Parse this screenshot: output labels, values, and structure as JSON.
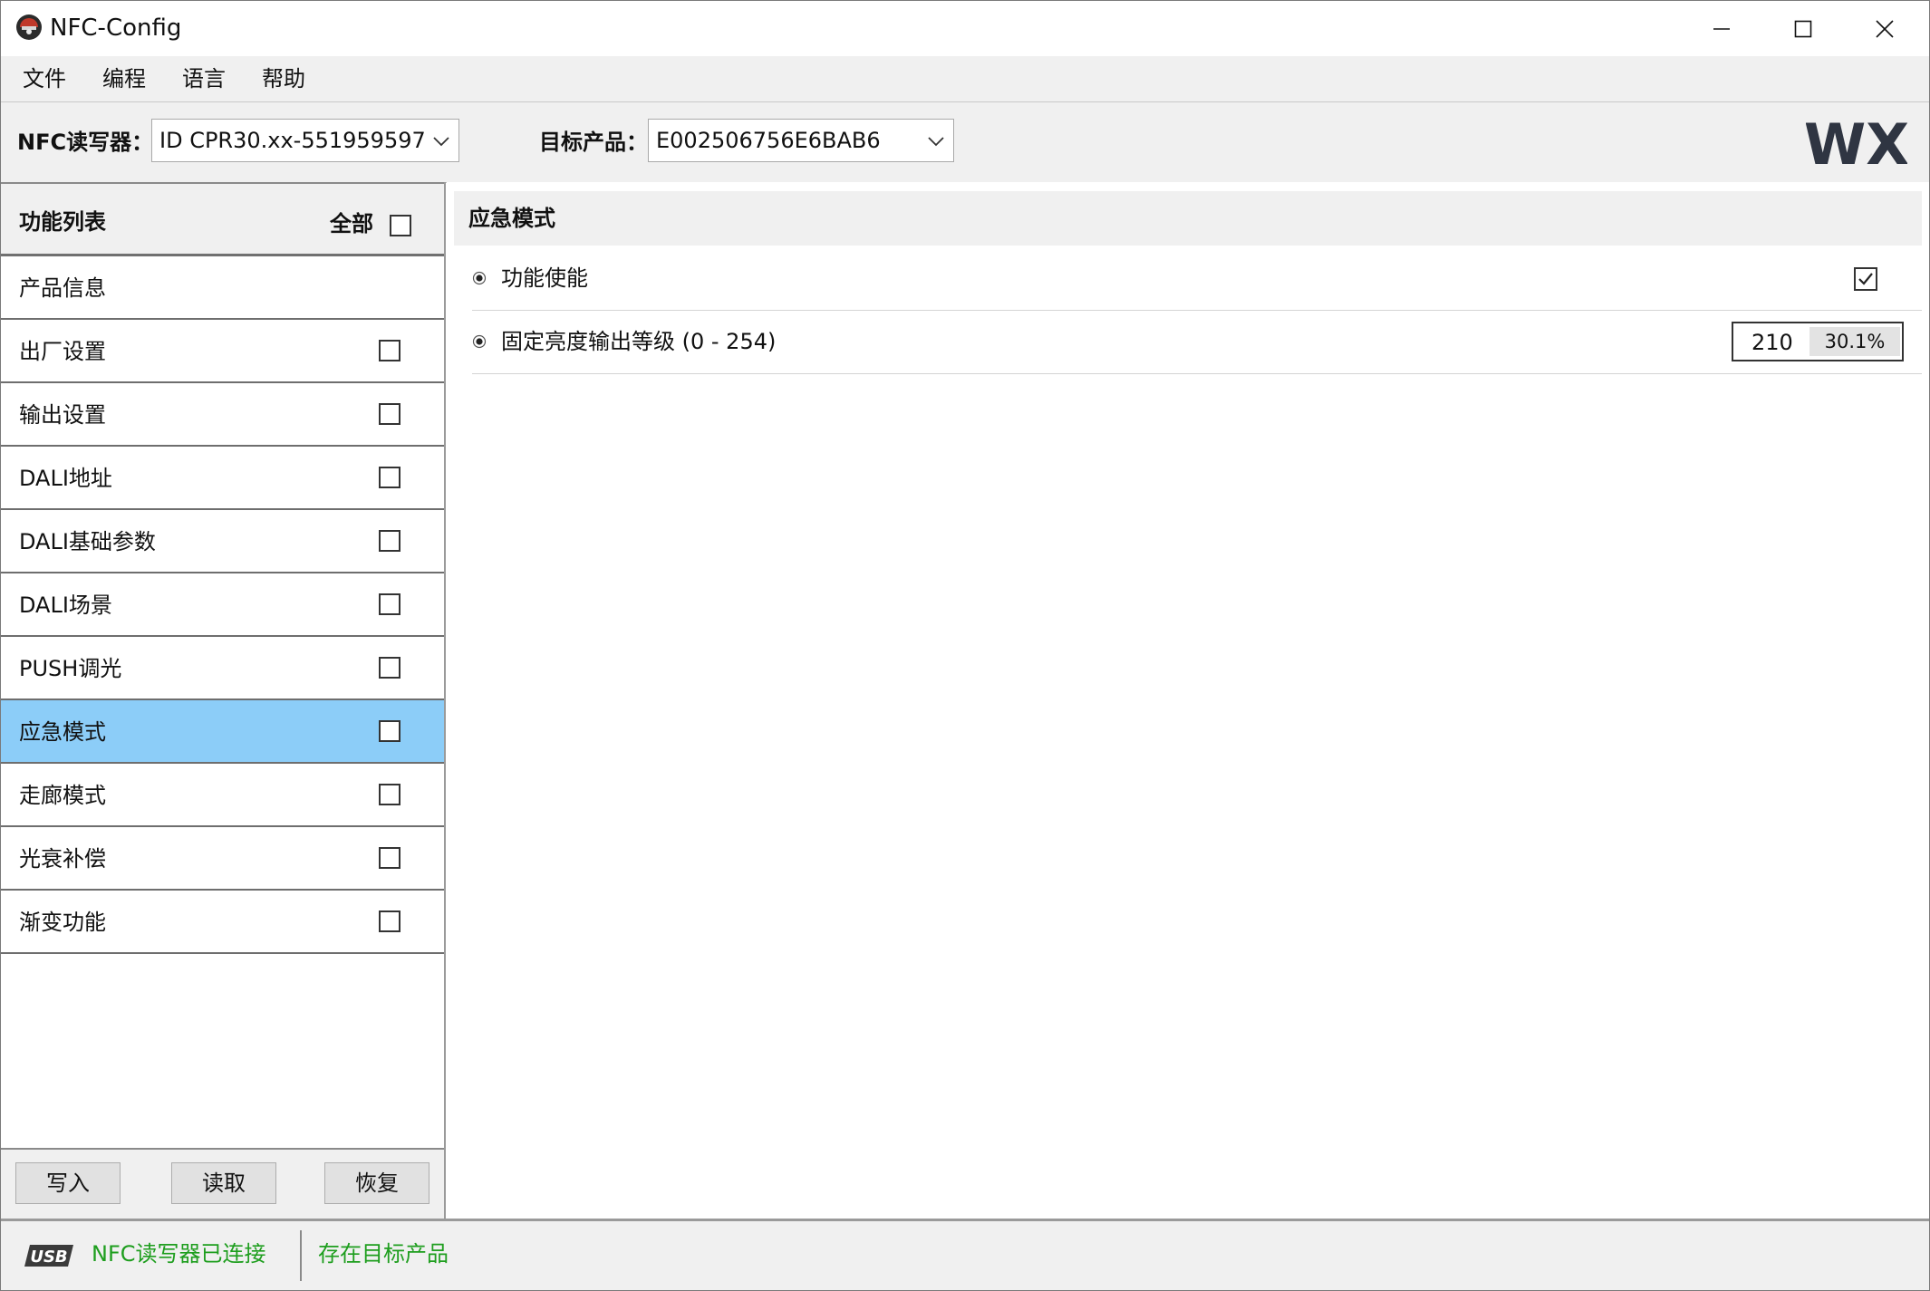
{
  "window": {
    "title": "NFC-Config",
    "controls": [
      "minimize",
      "maximize",
      "close"
    ]
  },
  "menu": {
    "items": [
      "文件",
      "编程",
      "语言",
      "帮助"
    ]
  },
  "toolbar": {
    "reader_label": "NFC读写器：",
    "reader_value": "ID CPR30.xx-551959597",
    "target_label": "目标产品：",
    "target_value": "E002506756E6BAB6",
    "brand_logo": "WX"
  },
  "feature_panel": {
    "title": "功能列表",
    "select_all_label": "全部",
    "select_all_checked": false,
    "items": [
      {
        "label": "产品信息",
        "has_checkbox": false,
        "checked": false,
        "selected": false
      },
      {
        "label": "出厂设置",
        "has_checkbox": true,
        "checked": false,
        "selected": false
      },
      {
        "label": "输出设置",
        "has_checkbox": true,
        "checked": false,
        "selected": false
      },
      {
        "label": "DALI地址",
        "has_checkbox": true,
        "checked": false,
        "selected": false
      },
      {
        "label": "DALI基础参数",
        "has_checkbox": true,
        "checked": false,
        "selected": false
      },
      {
        "label": "DALI场景",
        "has_checkbox": true,
        "checked": false,
        "selected": false
      },
      {
        "label": "PUSH调光",
        "has_checkbox": true,
        "checked": false,
        "selected": false
      },
      {
        "label": "应急模式",
        "has_checkbox": true,
        "checked": false,
        "selected": true
      },
      {
        "label": "走廊模式",
        "has_checkbox": true,
        "checked": false,
        "selected": false
      },
      {
        "label": "光衰补偿",
        "has_checkbox": true,
        "checked": false,
        "selected": false
      },
      {
        "label": "渐变功能",
        "has_checkbox": true,
        "checked": false,
        "selected": false
      }
    ],
    "buttons": {
      "write": "写入",
      "read": "读取",
      "restore": "恢复"
    }
  },
  "detail_panel": {
    "title": "应急模式",
    "settings": {
      "enable": {
        "label": "功能使能",
        "checked": true
      },
      "level": {
        "label": "固定亮度输出等级 (0 - 254)",
        "value": "210",
        "percent": "30.1%"
      }
    }
  },
  "status_bar": {
    "usb_icon_label": "USB",
    "reader_status": "NFC读写器已连接",
    "target_status": "存在目标产品"
  },
  "colors": {
    "selected_row": "#8ccdf8",
    "status_text": "#1e9e1e",
    "chrome_background": "#f0f0f0"
  }
}
